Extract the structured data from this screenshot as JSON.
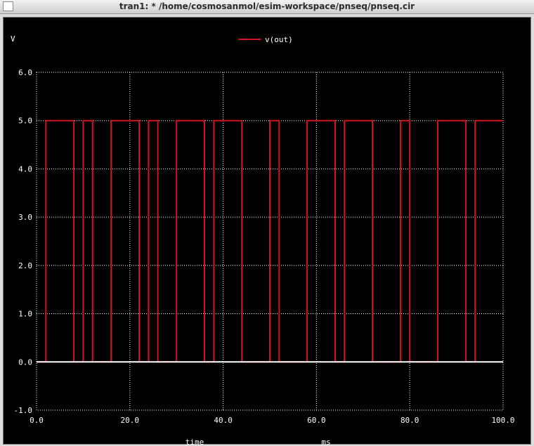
{
  "window": {
    "title": "tran1: * /home/cosmosanmol/esim-workspace/pnseq/pnseq.cir"
  },
  "colors": {
    "background": "#000000",
    "grid": "#ffffff",
    "trace": "#d0131c",
    "text": "#ffffff"
  },
  "chart_data": {
    "type": "line",
    "title": "",
    "xlabel": "time",
    "xunit": "ms",
    "ylabel": "V",
    "xlim": [
      0,
      100
    ],
    "ylim": [
      -1,
      6
    ],
    "grid": true,
    "legend_position": "top-center",
    "x_ticks": [
      0,
      20,
      40,
      60,
      80,
      100
    ],
    "y_ticks": [
      -1,
      0,
      1,
      2,
      3,
      4,
      5,
      6
    ],
    "x_tick_labels": [
      "0.0",
      "20.0",
      "40.0",
      "60.0",
      "80.0",
      "100.0"
    ],
    "y_tick_labels": [
      "-1.0",
      "0.0",
      "1.0",
      "2.0",
      "3.0",
      "4.0",
      "5.0",
      "6.0"
    ],
    "series": [
      {
        "name": "v(out)",
        "x": [
          0,
          2,
          2,
          8,
          8,
          10,
          10,
          12,
          12,
          16,
          16,
          22,
          22,
          24,
          24,
          26,
          26,
          30,
          30,
          36,
          36,
          38,
          38,
          44,
          44,
          50,
          50,
          52,
          52,
          58,
          58,
          64,
          64,
          66,
          66,
          72,
          72,
          78,
          78,
          80,
          80,
          86,
          86,
          92,
          92,
          94,
          94,
          100
        ],
        "y": [
          0,
          0,
          5,
          5,
          0,
          0,
          5,
          5,
          0,
          0,
          5,
          5,
          0,
          0,
          5,
          5,
          0,
          0,
          5,
          5,
          0,
          0,
          5,
          5,
          0,
          0,
          5,
          5,
          0,
          0,
          5,
          5,
          0,
          0,
          5,
          5,
          0,
          0,
          5,
          5,
          0,
          0,
          5,
          5,
          0,
          0,
          5,
          5
        ]
      }
    ]
  }
}
